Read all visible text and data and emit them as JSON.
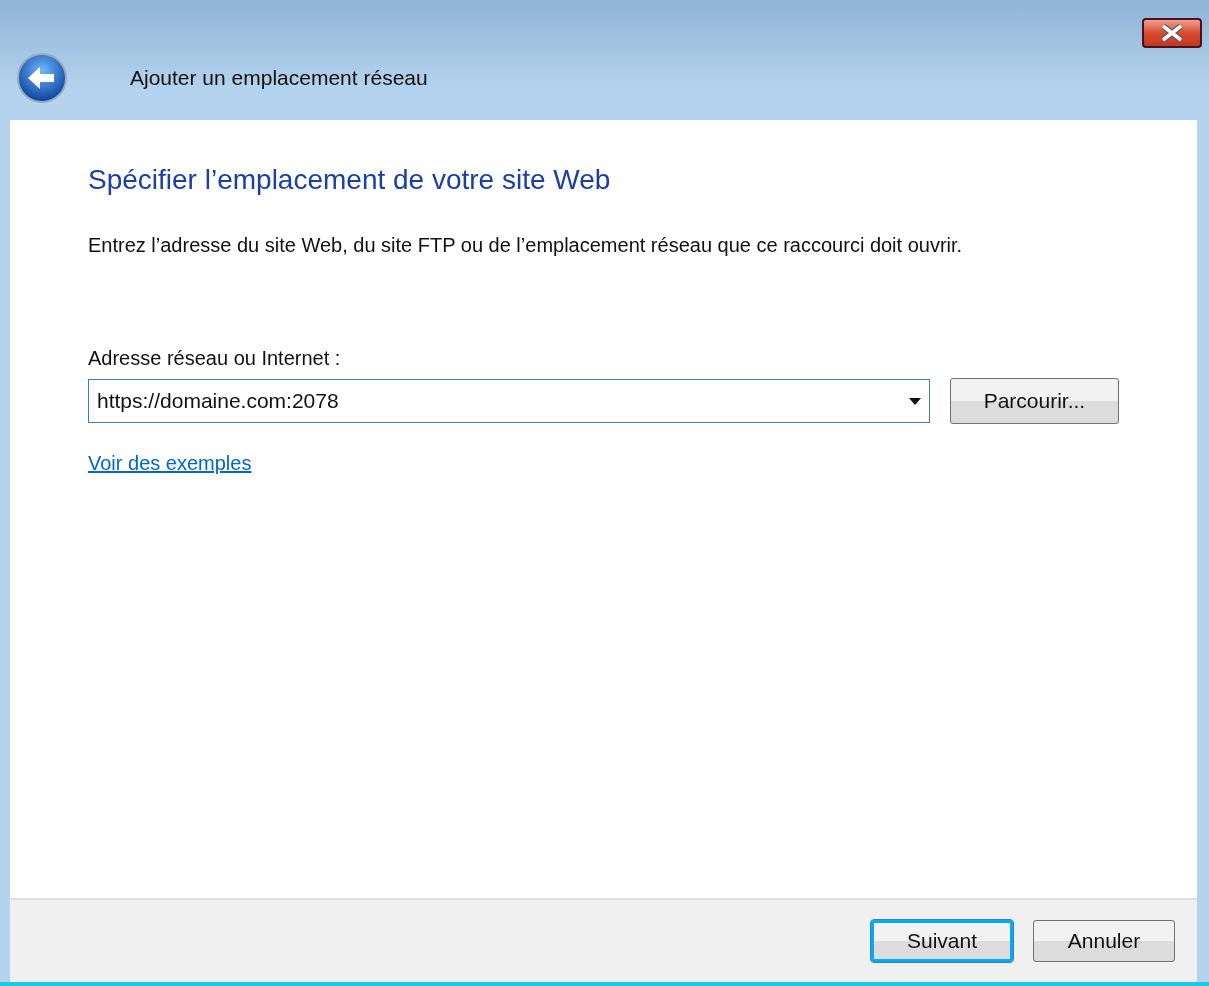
{
  "window": {
    "title": "Ajouter un emplacement réseau"
  },
  "heading": "Spécifier l’emplacement de votre site Web",
  "instruction": "Entrez l’adresse du site Web, du site FTP ou de l’emplacement réseau que ce raccourci doit ouvrir.",
  "address": {
    "label": "Adresse réseau ou Internet :",
    "value": "https://domaine.com:2078",
    "focused": true
  },
  "browse_button": "Parcourir...",
  "examples_link": "Voir des exemples",
  "buttons": [
    {
      "label": "Suivant",
      "default": true
    },
    {
      "label": "Annuler",
      "default": false
    }
  ]
}
